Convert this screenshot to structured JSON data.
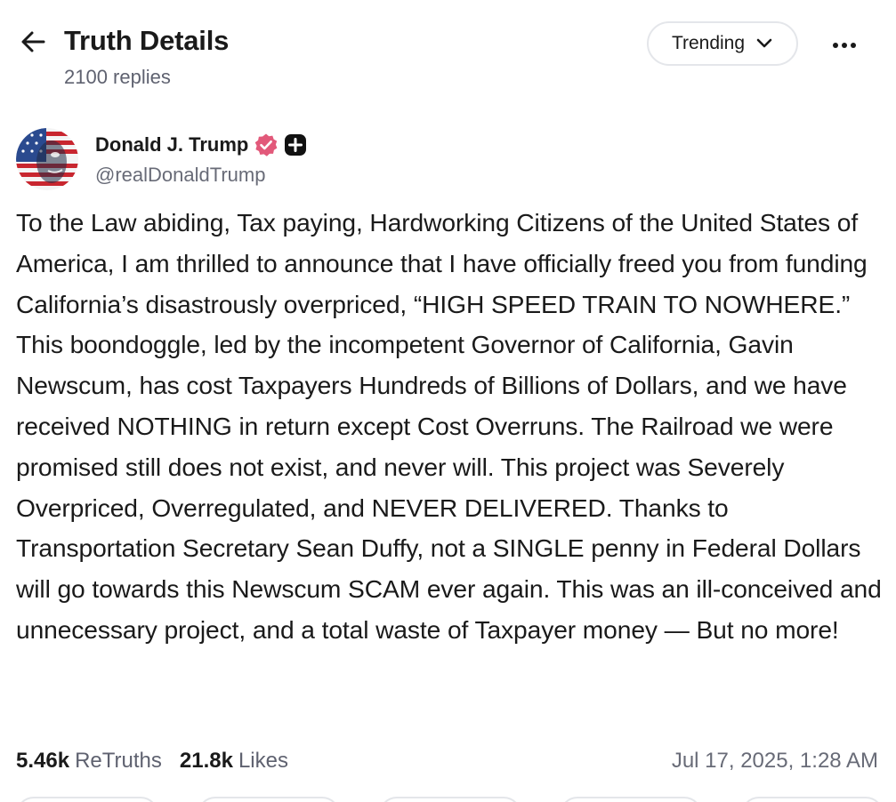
{
  "header": {
    "title": "Truth Details",
    "reply_count": "2100 replies",
    "sort_label": "Trending",
    "back_icon": "arrow-left-icon",
    "more_icon": "more-horizontal-icon"
  },
  "author": {
    "name": "Donald J. Trump",
    "handle": "@realDonaldTrump",
    "verified_badge_color": "#e2597a",
    "badges": [
      "verified-badge-icon",
      "plus-badge-icon"
    ]
  },
  "post": {
    "text": "To the Law abiding, Tax paying, Hardworking Citizens of the United States of America, I am thrilled to announce that I have officially freed you from funding California’s disastrously overpriced, “HIGH SPEED TRAIN TO NOWHERE.” This boondoggle, led by the incompetent Governor of California, Gavin Newscum, has cost Taxpayers Hundreds of Billions of Dollars, and we have received NOTHING in return except Cost Overruns. The Railroad we were promised still does not exist, and never will. This project was Severely Overpriced, Overregulated, and NEVER DELIVERED. Thanks to Transportation Secretary Sean Duffy, not a SINGLE penny in Federal Dollars will go towards this Newscum SCAM ever again. This was an ill-conceived and unnecessary project, and a total waste of Taxpayer money — But no more!"
  },
  "stats": {
    "retruths_count": "5.46k",
    "retruths_label": "ReTruths",
    "likes_count": "21.8k",
    "likes_label": "Likes",
    "timestamp": "Jul 17, 2025, 1:28 AM"
  },
  "colors": {
    "text_primary": "#1a1a1a",
    "text_secondary": "#5f6270",
    "border": "#e4e6ea"
  }
}
